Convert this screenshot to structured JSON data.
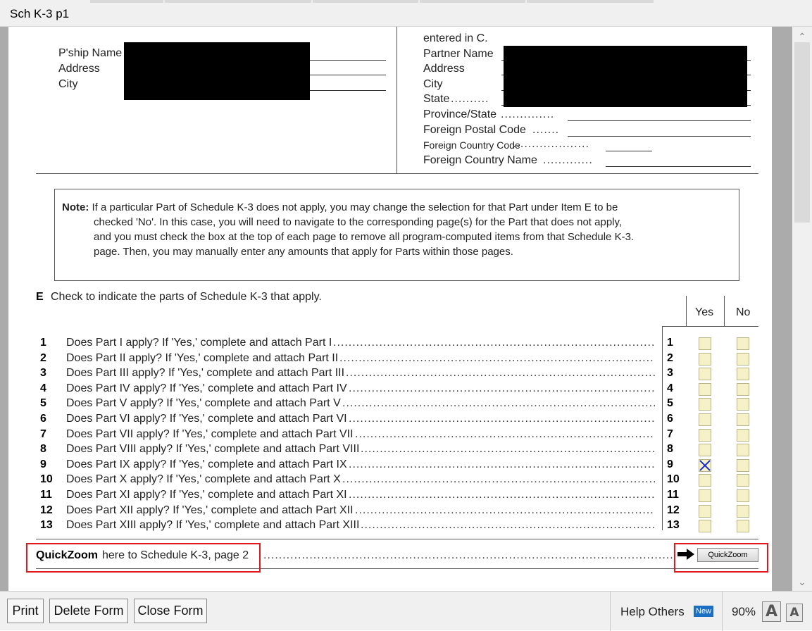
{
  "window": {
    "title": "Sch K-3 p1"
  },
  "partnership": {
    "name_label": "P'ship Name",
    "address_label": "Address",
    "city_label": "City"
  },
  "partner": {
    "top_text": "entered in C.",
    "name_label": "Partner Name",
    "address_label": "Address",
    "city_label": "City",
    "state_label": "State",
    "province_label": "Province/State",
    "postal_label": "Foreign Postal Code",
    "country_code_label": "Foreign Country Code",
    "country_name_label": "Foreign Country Name"
  },
  "note": {
    "label": "Note:",
    "line1": "If a particular Part of Schedule K-3 does not apply, you may change the selection for that Part under Item E to be",
    "line2": "checked 'No'. In this case, you will need to navigate to the corresponding page(s) for the Part that does not apply,",
    "line3": "and you must check the box at the top of each page to remove all program-computed items from that Schedule K-3.",
    "line4": "page. Then, you may manually enter any amounts that apply for Parts within those pages."
  },
  "section_e": {
    "letter": "E",
    "heading": "Check to indicate the parts of Schedule K-3 that apply.",
    "yes_label": "Yes",
    "no_label": "No",
    "rows": [
      {
        "num": "1",
        "text": "Does Part I apply? If 'Yes,' complete and attach Part I",
        "yes": false,
        "no": false
      },
      {
        "num": "2",
        "text": "Does Part II apply? If 'Yes,' complete and attach Part II",
        "yes": false,
        "no": false
      },
      {
        "num": "3",
        "text": "Does Part III apply? If 'Yes,' complete and attach Part III",
        "yes": false,
        "no": false
      },
      {
        "num": "4",
        "text": "Does Part IV apply? If 'Yes,' complete and attach Part IV",
        "yes": false,
        "no": false
      },
      {
        "num": "5",
        "text": "Does Part V apply? If 'Yes,' complete and attach Part V",
        "yes": false,
        "no": false
      },
      {
        "num": "6",
        "text": "Does Part VI apply? If 'Yes,' complete and attach Part VI",
        "yes": false,
        "no": false
      },
      {
        "num": "7",
        "text": "Does Part VII apply? If 'Yes,' complete and attach Part VII",
        "yes": false,
        "no": false
      },
      {
        "num": "8",
        "text": "Does Part VIII apply? If 'Yes,' complete and attach Part VIII",
        "yes": false,
        "no": false
      },
      {
        "num": "9",
        "text": "Does Part IX apply? If 'Yes,' complete and attach Part IX",
        "yes": true,
        "no": false
      },
      {
        "num": "10",
        "text": "Does Part X apply? If 'Yes,' complete and attach Part X",
        "yes": false,
        "no": false
      },
      {
        "num": "11",
        "text": "Does Part XI apply? If 'Yes,' complete and attach Part XI",
        "yes": false,
        "no": false
      },
      {
        "num": "12",
        "text": "Does Part XII apply? If 'Yes,' complete and attach Part XII",
        "yes": false,
        "no": false
      },
      {
        "num": "13",
        "text": "Does Part XIII apply? If 'Yes,' complete and attach Part XIII",
        "yes": false,
        "no": false
      }
    ]
  },
  "quickzoom": {
    "bold": "QuickZoom",
    "text": "here to Schedule K-3, page 2",
    "button_label": "QuickZoom"
  },
  "bottom": {
    "print": "Print",
    "delete": "Delete Form",
    "close": "Close Form",
    "help_others": "Help Others",
    "new_badge": "New",
    "zoom": "90%",
    "font_large": "A",
    "font_small": "A"
  },
  "colors": {
    "checkbox_fill": "#f6f1c6",
    "check_mark": "#1a2bd0",
    "highlight_box": "#e0191f",
    "new_badge": "#1a6fc4"
  }
}
